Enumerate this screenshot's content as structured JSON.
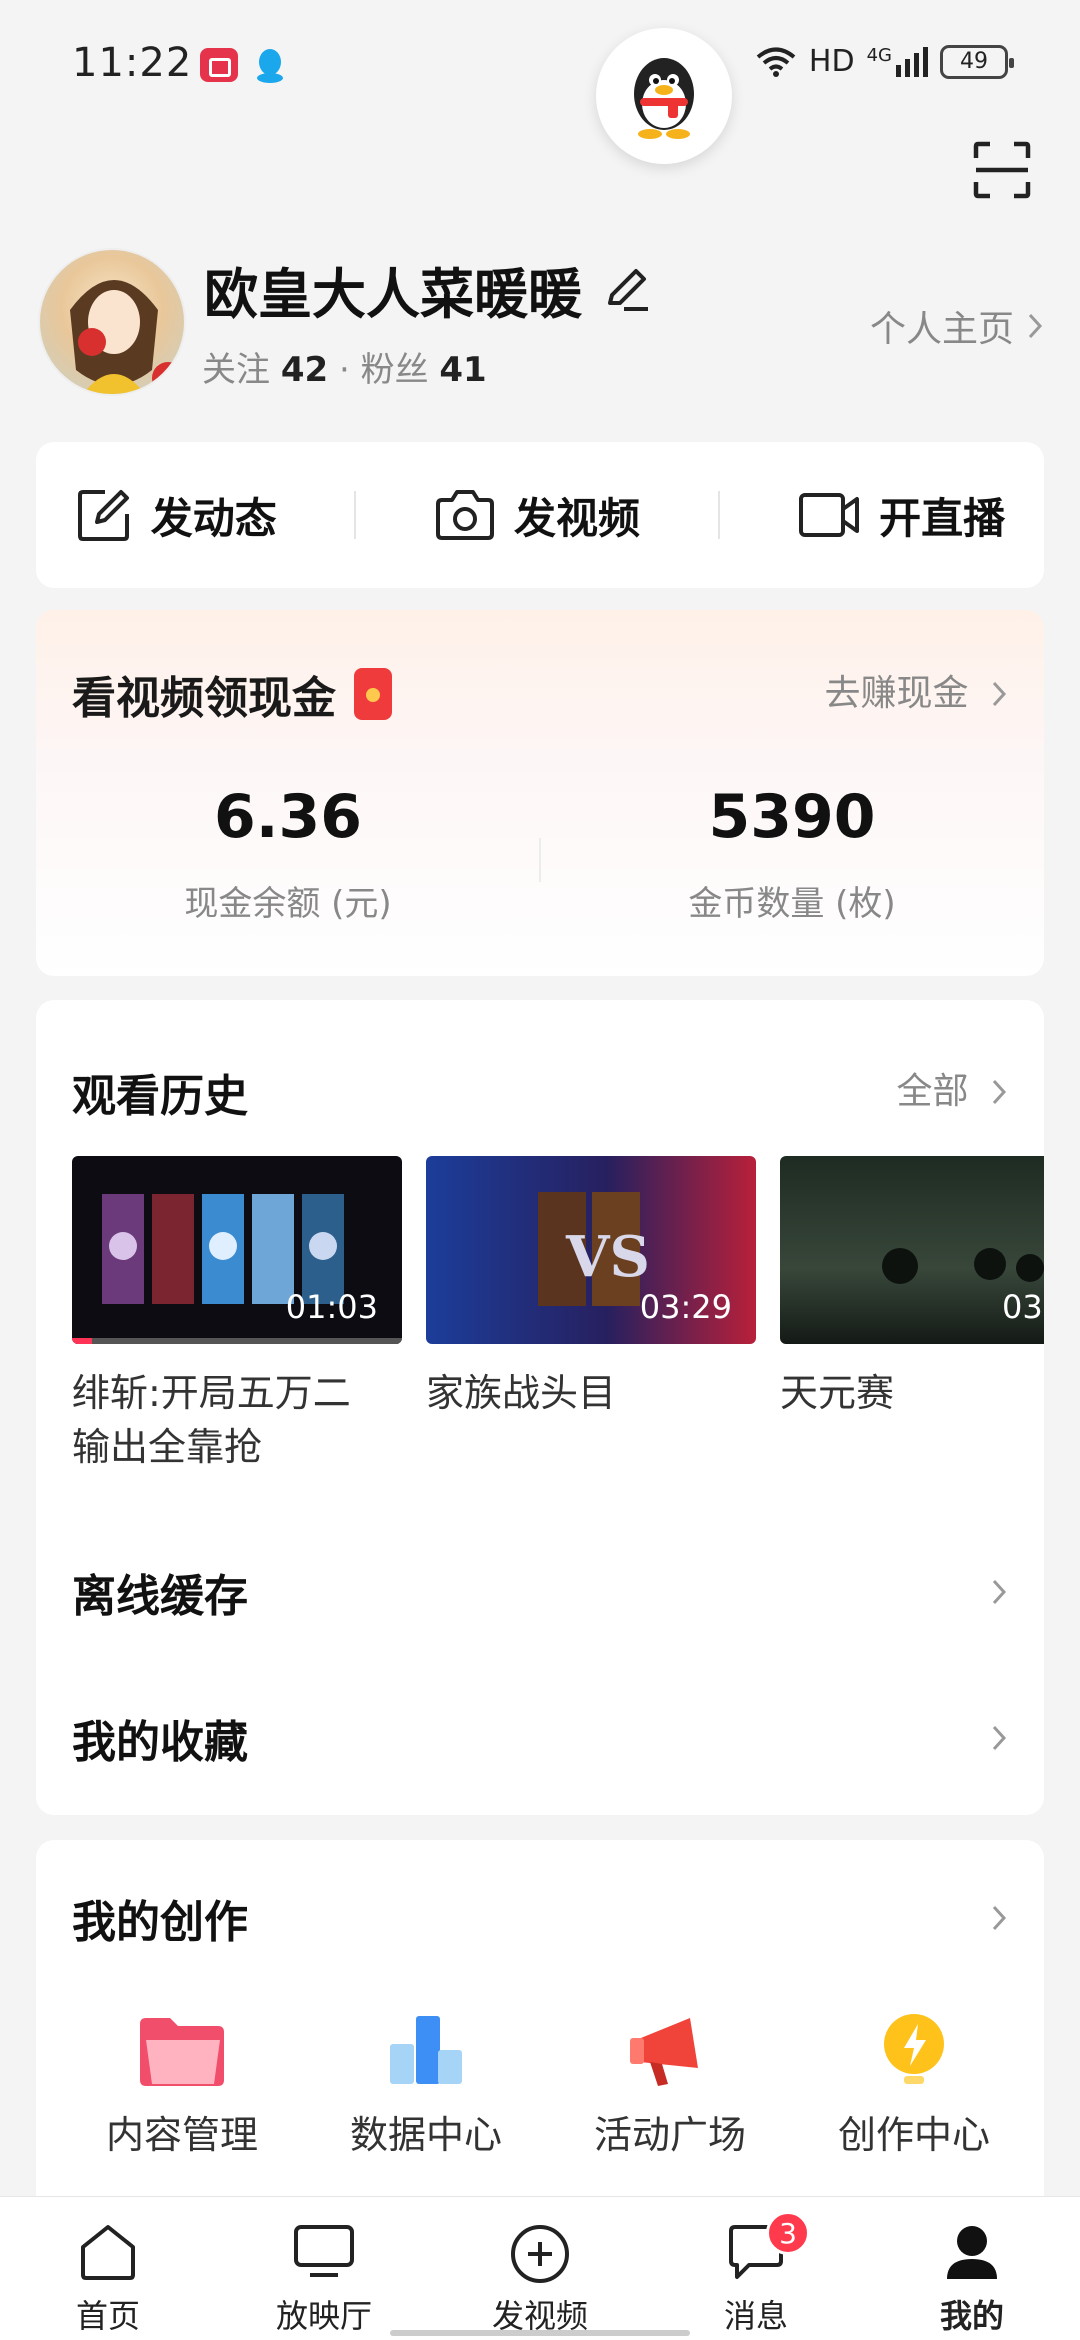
{
  "status_bar": {
    "time": "11:22",
    "network": "HD",
    "signal": "4G",
    "battery": "49"
  },
  "profile": {
    "username": "欧皇大人菜暖暖",
    "follow_label": "关注",
    "follow_count": "42",
    "separator": "·",
    "fans_label": "粉丝",
    "fans_count": "41",
    "homepage_link": "个人主页"
  },
  "actions": [
    {
      "label": "发动态",
      "icon": "edit-square-icon"
    },
    {
      "label": "发视频",
      "icon": "camera-icon"
    },
    {
      "label": "开直播",
      "icon": "video-camera-icon"
    }
  ],
  "cash": {
    "title": "看视频领现金",
    "link": "去赚现金",
    "balance_value": "6.36",
    "balance_label": "现金余额 (元)",
    "coins_value": "5390",
    "coins_label": "金币数量 (枚)"
  },
  "history": {
    "title": "观看历史",
    "more": "全部",
    "items": [
      {
        "title": "绯斩:开局五万二输出全靠抢",
        "duration": "01:03",
        "progress": 0.06
      },
      {
        "title": "家族战头目",
        "duration": "03:29",
        "progress": 0
      },
      {
        "title": "天元赛",
        "duration": "03:",
        "progress": 0
      }
    ]
  },
  "menu": {
    "offline": "离线缓存",
    "favorites": "我的收藏"
  },
  "creation": {
    "title": "我的创作",
    "items": [
      {
        "label": "内容管理",
        "icon": "folder-icon"
      },
      {
        "label": "数据中心",
        "icon": "bar-chart-icon"
      },
      {
        "label": "活动广场",
        "icon": "megaphone-icon"
      },
      {
        "label": "创作中心",
        "icon": "lightbulb-icon"
      }
    ]
  },
  "nav": [
    {
      "label": "首页",
      "icon": "home-icon"
    },
    {
      "label": "放映厅",
      "icon": "tv-icon"
    },
    {
      "label": "发视频",
      "icon": "plus-circle-icon"
    },
    {
      "label": "消息",
      "icon": "message-icon",
      "badge": "3"
    },
    {
      "label": "我的",
      "icon": "profile-icon"
    }
  ],
  "colors": {
    "accent_red": "#ff3a4d",
    "text_primary": "#111111",
    "text_secondary": "#888888"
  }
}
